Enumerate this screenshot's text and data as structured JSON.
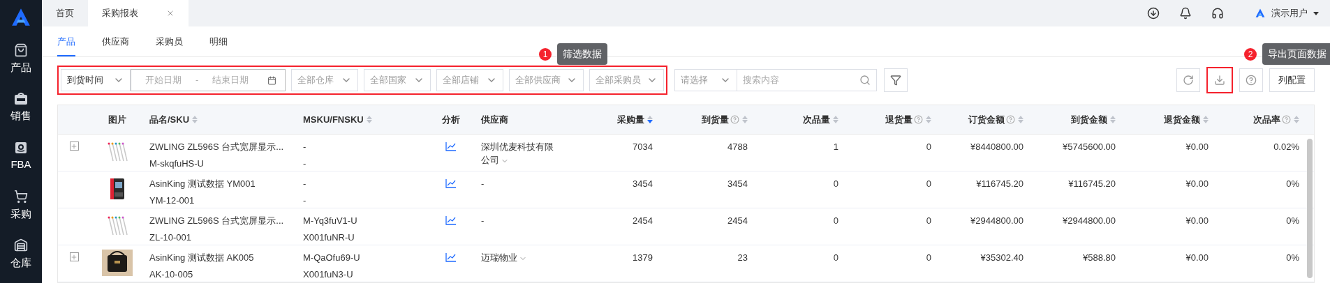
{
  "sidebar": {
    "items": [
      {
        "label": "产品"
      },
      {
        "label": "销售"
      },
      {
        "label": "FBA"
      },
      {
        "label": "采购"
      },
      {
        "label": "仓库"
      }
    ]
  },
  "tabs": [
    {
      "label": "首页",
      "selected": false,
      "closable": false
    },
    {
      "label": "采购报表",
      "selected": true,
      "closable": true
    }
  ],
  "header": {
    "user": "演示用户"
  },
  "sub_tabs": [
    {
      "label": "产品",
      "selected": true
    },
    {
      "label": "供应商",
      "selected": false
    },
    {
      "label": "采购员",
      "selected": false
    },
    {
      "label": "明细",
      "selected": false
    }
  ],
  "filters": {
    "highlighted": true,
    "annotation": {
      "number": "1",
      "text": "筛选数据"
    },
    "time_type": "到货时间",
    "date_start_placeholder": "开始日期",
    "date_separator": "-",
    "date_end_placeholder": "结束日期",
    "selects": [
      "全部仓库",
      "全部国家",
      "全部店铺",
      "全部供应商",
      "全部采购员"
    ]
  },
  "search": {
    "type_placeholder": "请选择",
    "placeholder": "搜索内容"
  },
  "actions": {
    "export": {
      "highlighted": true,
      "annotation": {
        "number": "2",
        "text": "导出页面数据"
      }
    },
    "column_config": "列配置"
  },
  "table": {
    "columns": [
      {
        "label": "图片",
        "sortable": false,
        "help": false,
        "sorted": false
      },
      {
        "label": "品名/SKU",
        "sortable": true,
        "help": false,
        "sorted": false
      },
      {
        "label": "MSKU/FNSKU",
        "sortable": true,
        "help": false,
        "sorted": false
      },
      {
        "label": "分析",
        "sortable": false,
        "help": false,
        "sorted": false
      },
      {
        "label": "供应商",
        "sortable": false,
        "help": false,
        "sorted": false
      },
      {
        "label": "采购量",
        "sortable": true,
        "help": false,
        "sorted": true
      },
      {
        "label": "到货量",
        "sortable": true,
        "help": true,
        "sorted": false
      },
      {
        "label": "次品量",
        "sortable": true,
        "help": false,
        "sorted": false
      },
      {
        "label": "退货量",
        "sortable": true,
        "help": true,
        "sorted": false
      },
      {
        "label": "订货金额",
        "sortable": true,
        "help": true,
        "sorted": false
      },
      {
        "label": "到货金额",
        "sortable": true,
        "help": false,
        "sorted": false
      },
      {
        "label": "退货金额",
        "sortable": true,
        "help": false,
        "sorted": false
      },
      {
        "label": "次品率",
        "sortable": true,
        "help": true,
        "sorted": false
      }
    ],
    "rows": [
      {
        "expandable": true,
        "name": "ZWLING ZL596S 台式宽屏显示...",
        "sku": "M-skqfuHS-U",
        "msku": "-",
        "fnsku": "-",
        "supplier": "深圳优麦科技有限公司",
        "supplier_menu": true,
        "values": [
          "7034",
          "4788",
          "1",
          "0",
          "¥8440800.00",
          "¥5745600.00",
          "¥0.00",
          "0.02%"
        ]
      },
      {
        "expandable": false,
        "name": "AsinKing 测试数据 YM001",
        "sku": "YM-12-001",
        "msku": "-",
        "fnsku": "-",
        "supplier": "-",
        "supplier_menu": false,
        "values": [
          "3454",
          "3454",
          "0",
          "0",
          "¥116745.20",
          "¥116745.20",
          "¥0.00",
          "0%"
        ]
      },
      {
        "expandable": false,
        "name": "ZWLING ZL596S 台式宽屏显示...",
        "sku": "ZL-10-001",
        "msku": "M-Yq3fuV1-U",
        "fnsku": "X001fuNR-U",
        "supplier": "-",
        "supplier_menu": false,
        "values": [
          "2454",
          "2454",
          "0",
          "0",
          "¥2944800.00",
          "¥2944800.00",
          "¥0.00",
          "0%"
        ]
      },
      {
        "expandable": true,
        "name": "AsinKing 测试数据 AK005",
        "sku": "AK-10-005",
        "msku": "M-QaOfu69-U",
        "fnsku": "X001fuN3-U",
        "supplier": "迈瑞物业",
        "supplier_menu": true,
        "values": [
          "1379",
          "23",
          "0",
          "0",
          "¥35302.40",
          "¥588.80",
          "¥0.00",
          "0%"
        ]
      }
    ]
  }
}
